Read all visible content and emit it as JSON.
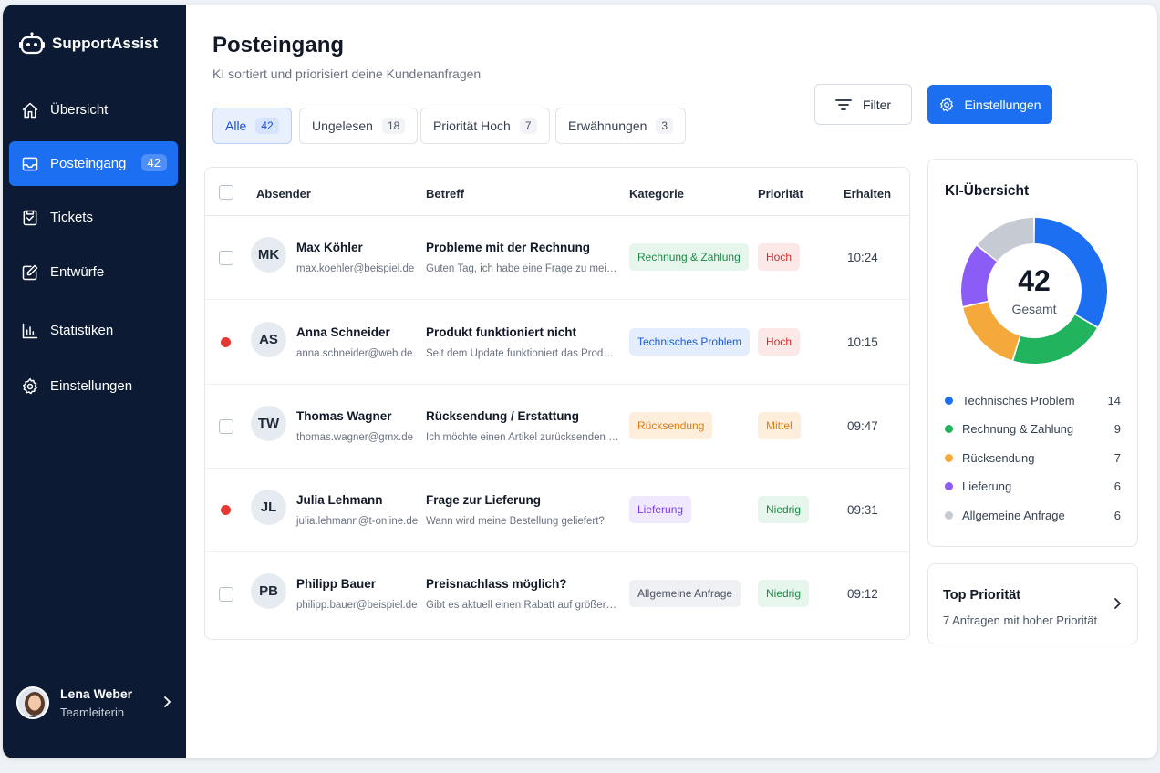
{
  "app": {
    "name": "SupportAssist",
    "logo_icon": "robot-icon"
  },
  "sidebar": {
    "items": [
      {
        "label": "Übersicht",
        "icon": "home-icon"
      },
      {
        "label": "Posteingang",
        "icon": "inbox-icon",
        "badge": "42",
        "active": true
      },
      {
        "label": "Tickets",
        "icon": "ticket-icon"
      },
      {
        "label": "Entwürfe",
        "icon": "edit-icon"
      },
      {
        "label": "Statistiken",
        "icon": "bar-chart-icon"
      },
      {
        "label": "Einstellungen",
        "icon": "gear-icon"
      }
    ],
    "user": {
      "name": "Lena Weber",
      "role": "Teamleiterin"
    }
  },
  "header": {
    "title": "Posteingang",
    "subtitle": "KI sortiert und priorisiert deine Kundenanfragen",
    "filter_label": "Filter",
    "settings_label": "Einstellungen"
  },
  "tabs": [
    {
      "label": "Alle",
      "count": "42",
      "active": true
    },
    {
      "label": "Ungelesen",
      "count": "18"
    },
    {
      "label": "Priorität Hoch",
      "count": "7"
    },
    {
      "label": "Erwähnungen",
      "count": "3"
    }
  ],
  "table": {
    "columns": [
      "Absender",
      "Betreff",
      "Kategorie",
      "Priorität",
      "Erhalten"
    ],
    "rows": [
      {
        "initials": "MK",
        "name": "Max Köhler",
        "email": "max.koehler@beispiel.de",
        "subject": "Probleme mit der Rechnung",
        "preview": "Guten Tag, ich habe eine Frage zu meiner Rechnung",
        "category": "Rechnung & Zahlung",
        "priority": "Hoch",
        "time": "10:24",
        "unread": false
      },
      {
        "initials": "AS",
        "name": "Anna Schneider",
        "email": "anna.schneider@web.de",
        "subject": "Produkt funktioniert nicht",
        "preview": "Seit dem Update funktioniert das Produkt nicht mehr",
        "category": "Technisches Problem",
        "priority": "Hoch",
        "time": "10:15",
        "unread": true
      },
      {
        "initials": "TW",
        "name": "Thomas Wagner",
        "email": "thomas.wagner@gmx.de",
        "subject": "Rücksendung / Erstattung",
        "preview": "Ich möchte einen Artikel zurücksenden und",
        "category": "Rücksendung",
        "priority": "Mittel",
        "time": "09:47",
        "unread": false
      },
      {
        "initials": "JL",
        "name": "Julia Lehmann",
        "email": "julia.lehmann@t-online.de",
        "subject": "Frage zur Lieferung",
        "preview": "Wann wird meine Bestellung geliefert?",
        "category": "Lieferung",
        "priority": "Niedrig",
        "time": "09:31",
        "unread": true
      },
      {
        "initials": "PB",
        "name": "Philipp Bauer",
        "email": "philipp.bauer@beispiel.de",
        "subject": "Preisnachlass möglich?",
        "preview": "Gibt es aktuell einen Rabatt auf größere Bestellungen",
        "category": "Allgemeine Anfrage",
        "priority": "Niedrig",
        "time": "09:12",
        "unread": false
      }
    ]
  },
  "overview": {
    "title": "KI-Übersicht",
    "total": "42",
    "total_label": "Gesamt",
    "categories": [
      {
        "name": "Technisches Problem",
        "value": 14,
        "color": "#1d6ff2"
      },
      {
        "name": "Rechnung & Zahlung",
        "value": 9,
        "color": "#22b35e"
      },
      {
        "name": "Rücksendung",
        "value": 7,
        "color": "#f5a93a"
      },
      {
        "name": "Lieferung",
        "value": 6,
        "color": "#8b5cf6"
      },
      {
        "name": "Allgemeine Anfrage",
        "value": 6,
        "color": "#c5cad3"
      }
    ]
  },
  "top_priority": {
    "title": "Top Priorität",
    "subtitle": "7 Anfragen mit hoher Priorität"
  }
}
